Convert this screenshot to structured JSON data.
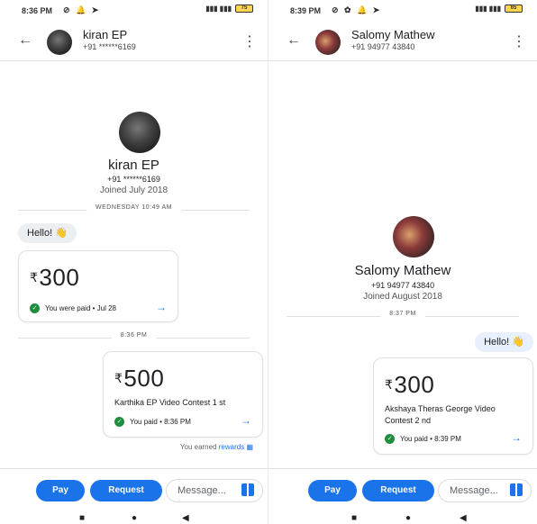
{
  "left": {
    "status_time": "8:36 PM",
    "battery": "75",
    "header_name": "kiran EP",
    "header_phone": "+91 ******6169",
    "profile_name": "kiran EP",
    "profile_phone": "+91 ******6169",
    "profile_joined": "Joined July 2018",
    "sep1": "WEDNESDAY 10:49 AM",
    "hello": "Hello! 👋",
    "card1": {
      "currency": "₹",
      "amount": "300",
      "status": "You were paid • Jul 28"
    },
    "sep2": "8:36 PM",
    "card2": {
      "currency": "₹",
      "amount": "500",
      "desc": "Karthika EP Video Contest 1 st",
      "status": "You paid • 8:36 PM"
    },
    "rewards_prefix": "You earned ",
    "rewards_link": "rewards"
  },
  "right": {
    "status_time": "8:39 PM",
    "battery": "65",
    "header_name": "Salomy Mathew",
    "header_phone": "+91 94977 43840",
    "profile_name": "Salomy Mathew",
    "profile_phone": "+91 94977 43840",
    "profile_joined": "Joined August 2018",
    "sep1": "8:37 PM",
    "hello": "Hello! 👋",
    "card1": {
      "currency": "₹",
      "amount": "300",
      "desc": "Akshaya Theras George Video Contest 2 nd",
      "status": "You paid • 8:39 PM"
    }
  },
  "bottom": {
    "pay": "Pay",
    "request": "Request",
    "message_placeholder": "Message..."
  },
  "colors": {
    "accent": "#1a73e8",
    "success": "#1e8e3e"
  },
  "icons": [
    "back-arrow-icon",
    "more-vert-icon",
    "check-circle-icon",
    "chevron-right-icon",
    "gift-icon",
    "rewards-icon"
  ]
}
